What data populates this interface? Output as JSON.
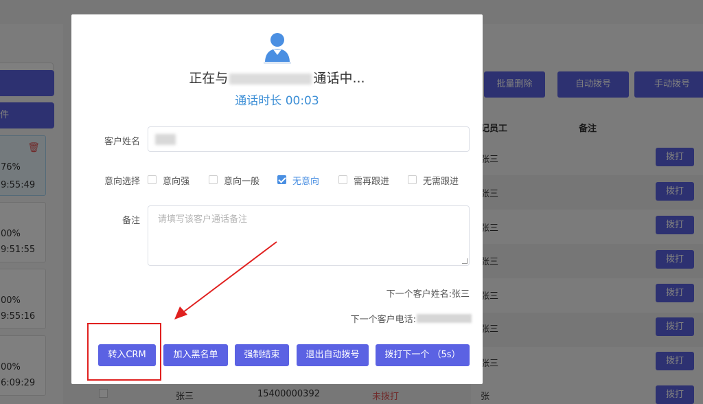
{
  "background": {
    "left_buttons": [
      "",
      "件"
    ],
    "task_cards": [
      {
        "percent": "76%",
        "time": "9:55:49",
        "active": true
      },
      {
        "percent": "00%",
        "time": "9:51:55"
      },
      {
        "percent": "00%",
        "time": "9:55:16"
      },
      {
        "percent": "00%",
        "time": "6:09:29"
      }
    ],
    "top_buttons": [
      "批量删除",
      "自动拨号",
      "手动拨号"
    ],
    "columns": [
      "记员工",
      "备注"
    ],
    "rows": [
      "张三",
      "张三",
      "张三",
      "张三",
      "张三",
      "张三",
      "张三"
    ],
    "dial_label": "拨打",
    "bottom_row": {
      "name": "张三",
      "phone": "15400000392",
      "status": "未拨打",
      "staff": "张三"
    }
  },
  "modal": {
    "call_prefix": "正在与",
    "call_suffix": "通话中...",
    "duration": "通话时长 00:03",
    "name_label": "客户姓名",
    "intent_label": "意向选择",
    "intent_options": [
      {
        "label": "意向强",
        "checked": false
      },
      {
        "label": "意向一般",
        "checked": false
      },
      {
        "label": "无意向",
        "checked": true
      },
      {
        "label": "需再跟进",
        "checked": false
      },
      {
        "label": "无需跟进",
        "checked": false
      }
    ],
    "remark_label": "备注",
    "remark_placeholder": "请填写该客户通话备注",
    "next_name": "下一个客户姓名:张三",
    "next_phone": "下一个客户电话:",
    "buttons": {
      "to_crm": "转入CRM",
      "blacklist": "加入黑名单",
      "force_end": "强制结束",
      "exit_auto": "退出自动拨号",
      "dial_next": "拨打下一个 （5s）"
    }
  },
  "colors": {
    "primary": "#5b62e3",
    "accent_blue": "#3d8fd6",
    "annotation_red": "#e0201f"
  }
}
